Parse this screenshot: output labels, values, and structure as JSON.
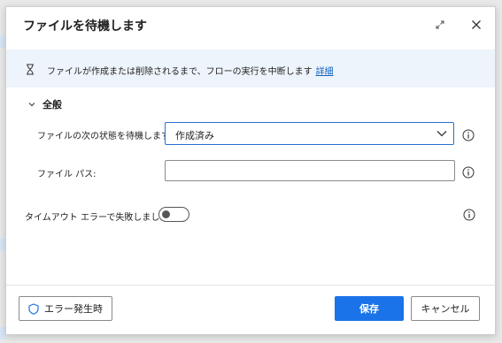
{
  "dialog": {
    "title": "ファイルを待機します",
    "info": {
      "message": "ファイルが作成または削除されるまで、フローの実行を中断します",
      "link": "詳細"
    },
    "section": {
      "label": "全般"
    },
    "fields": {
      "wait_state": {
        "label": "ファイルの次の状態を待機します:",
        "value": "作成済み"
      },
      "file_path": {
        "label": "ファイル パス:",
        "value": ""
      },
      "timeout": {
        "label": "タイムアウト エラーで失敗しました:",
        "enabled": false
      }
    },
    "footer": {
      "on_error": "エラー発生時",
      "save": "保存",
      "cancel": "キャンセル"
    }
  },
  "colors": {
    "accent": "#1a73e8",
    "info_bar": "#eef4fb",
    "link": "#1363c0"
  },
  "icons": [
    "expand-icon",
    "close-icon",
    "hourglass-icon",
    "chevron-down-icon",
    "info-icon",
    "shield-icon"
  ]
}
